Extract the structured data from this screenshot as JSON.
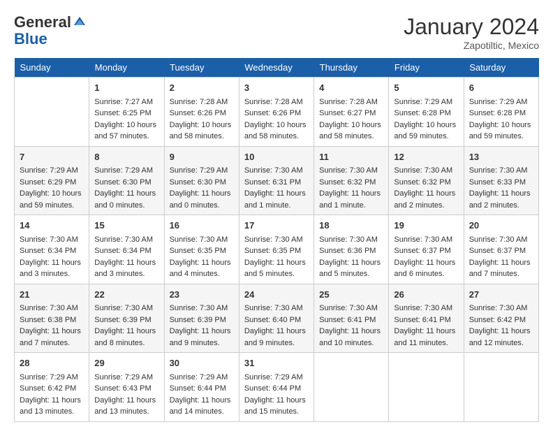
{
  "header": {
    "logo_general": "General",
    "logo_blue": "Blue",
    "month_year": "January 2024",
    "location": "Zapotiltic, Mexico"
  },
  "days_of_week": [
    "Sunday",
    "Monday",
    "Tuesday",
    "Wednesday",
    "Thursday",
    "Friday",
    "Saturday"
  ],
  "weeks": [
    [
      {
        "day": "",
        "data": ""
      },
      {
        "day": "1",
        "data": "Sunrise: 7:27 AM\nSunset: 6:25 PM\nDaylight: 10 hours\nand 57 minutes."
      },
      {
        "day": "2",
        "data": "Sunrise: 7:28 AM\nSunset: 6:26 PM\nDaylight: 10 hours\nand 58 minutes."
      },
      {
        "day": "3",
        "data": "Sunrise: 7:28 AM\nSunset: 6:26 PM\nDaylight: 10 hours\nand 58 minutes."
      },
      {
        "day": "4",
        "data": "Sunrise: 7:28 AM\nSunset: 6:27 PM\nDaylight: 10 hours\nand 58 minutes."
      },
      {
        "day": "5",
        "data": "Sunrise: 7:29 AM\nSunset: 6:28 PM\nDaylight: 10 hours\nand 59 minutes."
      },
      {
        "day": "6",
        "data": "Sunrise: 7:29 AM\nSunset: 6:28 PM\nDaylight: 10 hours\nand 59 minutes."
      }
    ],
    [
      {
        "day": "7",
        "data": "Sunrise: 7:29 AM\nSunset: 6:29 PM\nDaylight: 10 hours\nand 59 minutes."
      },
      {
        "day": "8",
        "data": "Sunrise: 7:29 AM\nSunset: 6:30 PM\nDaylight: 11 hours\nand 0 minutes."
      },
      {
        "day": "9",
        "data": "Sunrise: 7:29 AM\nSunset: 6:30 PM\nDaylight: 11 hours\nand 0 minutes."
      },
      {
        "day": "10",
        "data": "Sunrise: 7:30 AM\nSunset: 6:31 PM\nDaylight: 11 hours\nand 1 minute."
      },
      {
        "day": "11",
        "data": "Sunrise: 7:30 AM\nSunset: 6:32 PM\nDaylight: 11 hours\nand 1 minute."
      },
      {
        "day": "12",
        "data": "Sunrise: 7:30 AM\nSunset: 6:32 PM\nDaylight: 11 hours\nand 2 minutes."
      },
      {
        "day": "13",
        "data": "Sunrise: 7:30 AM\nSunset: 6:33 PM\nDaylight: 11 hours\nand 2 minutes."
      }
    ],
    [
      {
        "day": "14",
        "data": "Sunrise: 7:30 AM\nSunset: 6:34 PM\nDaylight: 11 hours\nand 3 minutes."
      },
      {
        "day": "15",
        "data": "Sunrise: 7:30 AM\nSunset: 6:34 PM\nDaylight: 11 hours\nand 3 minutes."
      },
      {
        "day": "16",
        "data": "Sunrise: 7:30 AM\nSunset: 6:35 PM\nDaylight: 11 hours\nand 4 minutes."
      },
      {
        "day": "17",
        "data": "Sunrise: 7:30 AM\nSunset: 6:35 PM\nDaylight: 11 hours\nand 5 minutes."
      },
      {
        "day": "18",
        "data": "Sunrise: 7:30 AM\nSunset: 6:36 PM\nDaylight: 11 hours\nand 5 minutes."
      },
      {
        "day": "19",
        "data": "Sunrise: 7:30 AM\nSunset: 6:37 PM\nDaylight: 11 hours\nand 6 minutes."
      },
      {
        "day": "20",
        "data": "Sunrise: 7:30 AM\nSunset: 6:37 PM\nDaylight: 11 hours\nand 7 minutes."
      }
    ],
    [
      {
        "day": "21",
        "data": "Sunrise: 7:30 AM\nSunset: 6:38 PM\nDaylight: 11 hours\nand 7 minutes."
      },
      {
        "day": "22",
        "data": "Sunrise: 7:30 AM\nSunset: 6:39 PM\nDaylight: 11 hours\nand 8 minutes."
      },
      {
        "day": "23",
        "data": "Sunrise: 7:30 AM\nSunset: 6:39 PM\nDaylight: 11 hours\nand 9 minutes."
      },
      {
        "day": "24",
        "data": "Sunrise: 7:30 AM\nSunset: 6:40 PM\nDaylight: 11 hours\nand 9 minutes."
      },
      {
        "day": "25",
        "data": "Sunrise: 7:30 AM\nSunset: 6:41 PM\nDaylight: 11 hours\nand 10 minutes."
      },
      {
        "day": "26",
        "data": "Sunrise: 7:30 AM\nSunset: 6:41 PM\nDaylight: 11 hours\nand 11 minutes."
      },
      {
        "day": "27",
        "data": "Sunrise: 7:30 AM\nSunset: 6:42 PM\nDaylight: 11 hours\nand 12 minutes."
      }
    ],
    [
      {
        "day": "28",
        "data": "Sunrise: 7:29 AM\nSunset: 6:42 PM\nDaylight: 11 hours\nand 13 minutes."
      },
      {
        "day": "29",
        "data": "Sunrise: 7:29 AM\nSunset: 6:43 PM\nDaylight: 11 hours\nand 13 minutes."
      },
      {
        "day": "30",
        "data": "Sunrise: 7:29 AM\nSunset: 6:44 PM\nDaylight: 11 hours\nand 14 minutes."
      },
      {
        "day": "31",
        "data": "Sunrise: 7:29 AM\nSunset: 6:44 PM\nDaylight: 11 hours\nand 15 minutes."
      },
      {
        "day": "",
        "data": ""
      },
      {
        "day": "",
        "data": ""
      },
      {
        "day": "",
        "data": ""
      }
    ]
  ]
}
